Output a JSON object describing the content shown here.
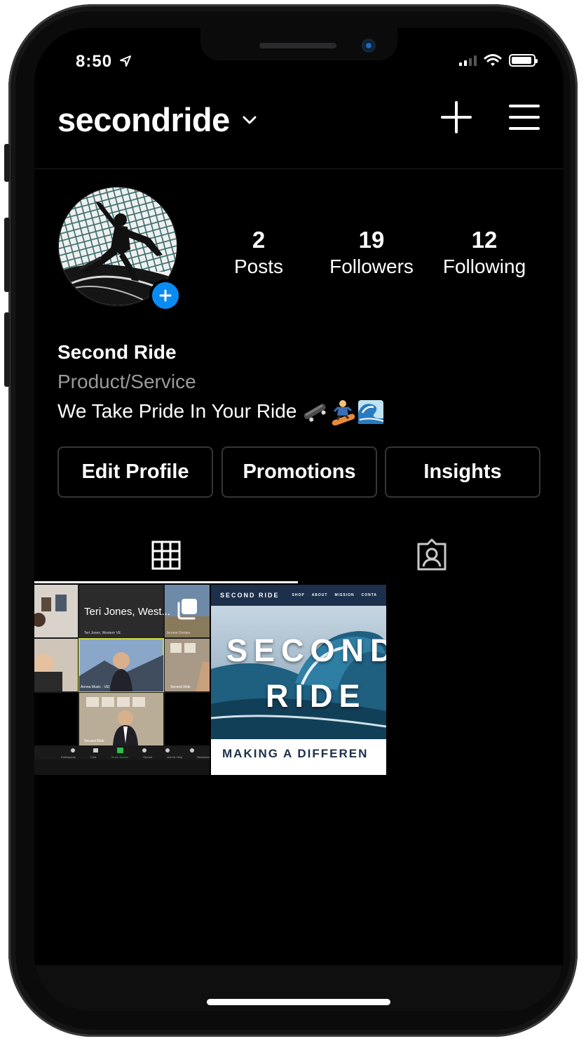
{
  "status_bar": {
    "time": "8:50"
  },
  "header": {
    "username": "secondride"
  },
  "profile": {
    "stats": [
      {
        "value": "2",
        "label": "Posts"
      },
      {
        "value": "19",
        "label": "Followers"
      },
      {
        "value": "12",
        "label": "Following"
      }
    ],
    "name": "Second Ride",
    "category": "Product/Service",
    "bio": "We Take Pride In Your Ride",
    "bio_emojis": "🛹🏂🌊"
  },
  "actions": {
    "edit": "Edit Profile",
    "promotions": "Promotions",
    "insights": "Insights"
  },
  "posts": {
    "post1": {
      "tile_name": "Teri Jones, West...",
      "labels": [
        "Teri Jones, Western VE",
        "Jerome Gentes",
        "Annna Music - VEI",
        "Second Ride",
        "Second Ride"
      ],
      "toolbar": [
        "Participants",
        "Chat",
        "Share Screen",
        "Record",
        "Ask for Help",
        "Reactions"
      ]
    },
    "post2": {
      "brand": "SECOND RIDE",
      "nav": [
        "SHOP",
        "ABOUT",
        "MISSION",
        "CONTA"
      ],
      "hero_line1": "SECOND",
      "hero_line2": "RIDE",
      "tagline": "MAKING A DIFFEREN"
    }
  },
  "colors": {
    "accent_blue": "#0a8bf2",
    "background": "#000000",
    "muted": "#9a9a9a"
  }
}
